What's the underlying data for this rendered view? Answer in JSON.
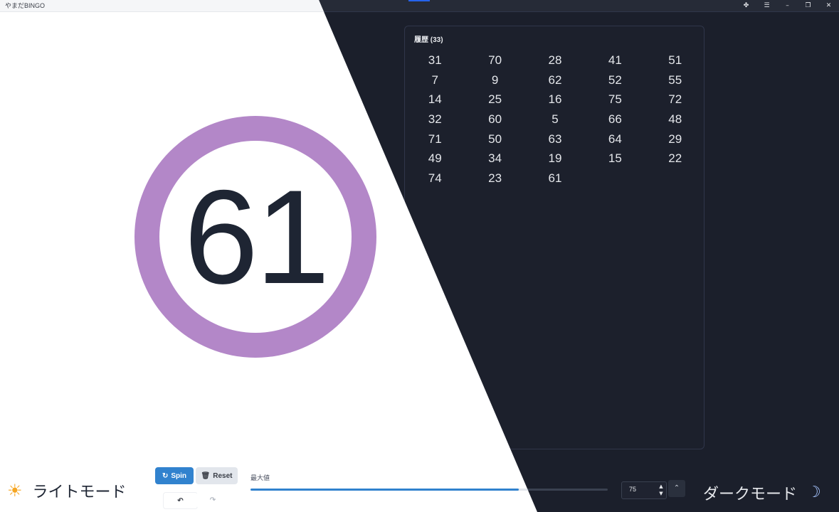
{
  "window": {
    "title": "やまだBINGO",
    "min_glyph": "–",
    "max_glyph": "❐",
    "close_glyph": "✕",
    "ext_glyph": "✤",
    "menu_glyph": "☰"
  },
  "current": {
    "number": "61",
    "ring_color": "#b387c8"
  },
  "history": {
    "heading": "履歴 (33)",
    "numbers": [
      "31",
      "70",
      "28",
      "41",
      "51",
      "7",
      "9",
      "62",
      "52",
      "55",
      "14",
      "25",
      "16",
      "75",
      "72",
      "32",
      "60",
      "5",
      "66",
      "48",
      "71",
      "50",
      "63",
      "64",
      "29",
      "49",
      "34",
      "19",
      "15",
      "22",
      "74",
      "23",
      "61"
    ]
  },
  "controls": {
    "spin_label": "Spin",
    "reset_label": "Reset",
    "spin_icon": "↻",
    "reset_icon": "🗑",
    "undo_icon": "↶",
    "redo_icon": "↷",
    "max_label": "最大値",
    "max_value": "75",
    "slider_fraction": 0.75,
    "collapse_icon": "⌃",
    "stepper_up": "▲",
    "stepper_down": "▼"
  },
  "modes": {
    "light_label": "ライトモード",
    "dark_label": "ダークモード",
    "sun_icon": "☀",
    "moon_icon": "☽"
  },
  "colors": {
    "accent": "#3182ce",
    "dark_bg": "#1b1f2b"
  }
}
